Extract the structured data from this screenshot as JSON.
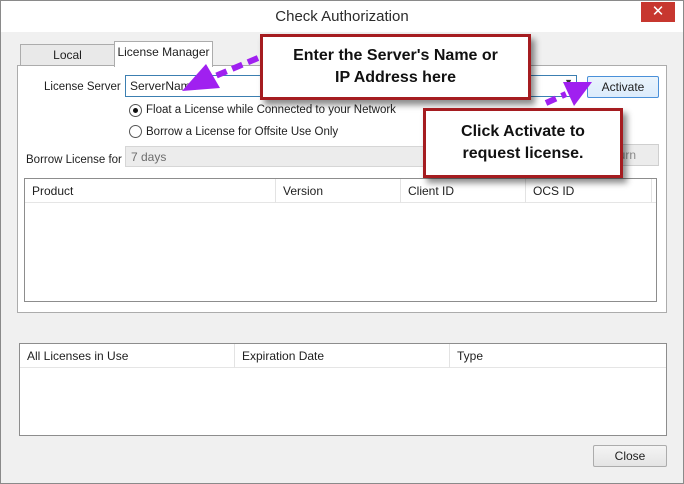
{
  "window": {
    "title": "Check Authorization",
    "close_glyph": "✕"
  },
  "tabs": [
    {
      "label": "Local"
    },
    {
      "label": "License Manager"
    }
  ],
  "license_server": {
    "label": "License Server",
    "value": "ServerName"
  },
  "activate_button": "Activate",
  "options": [
    {
      "label": "Float a License while Connected to your Network",
      "selected": true
    },
    {
      "label": "Borrow a License for Offsite Use Only",
      "selected": false
    }
  ],
  "borrow": {
    "label": "Borrow License for",
    "value": "7 days",
    "return_button": "urn"
  },
  "products_grid": {
    "columns": [
      "Product",
      "Version",
      "Client ID",
      "OCS ID"
    ]
  },
  "licenses_grid": {
    "columns": [
      "All Licenses in Use",
      "Expiration Date",
      "Type"
    ]
  },
  "close_button": "Close",
  "callouts": {
    "server": [
      "Enter the Server's Name or",
      "IP Address here"
    ],
    "activate": [
      "Click Activate to",
      "request license."
    ]
  },
  "colors": {
    "callout_border": "#a51c20",
    "arrow": "#a020f0",
    "accent": "#3c7fb1"
  },
  "icons": {
    "combo": "chevron-down-icon",
    "close": "close-icon"
  }
}
